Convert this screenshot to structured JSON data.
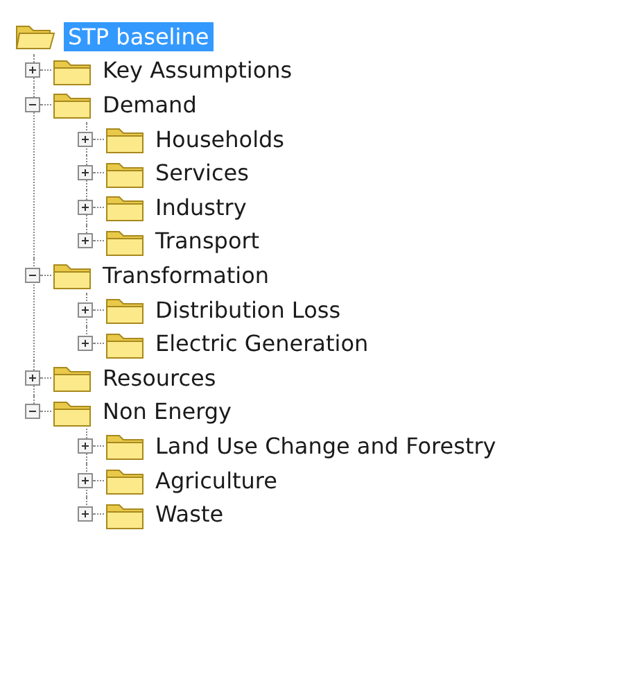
{
  "tree": {
    "label": "STP baseline",
    "selected": true,
    "children": [
      {
        "label": "Key Assumptions",
        "selected": false,
        "expanded": false
      },
      {
        "label": "Demand",
        "selected": false,
        "expanded": true,
        "children": [
          {
            "label": "Households",
            "selected": false,
            "expanded": false
          },
          {
            "label": "Services",
            "selected": false,
            "expanded": false
          },
          {
            "label": "Industry",
            "selected": false,
            "expanded": false
          },
          {
            "label": "Transport",
            "selected": false,
            "expanded": false
          }
        ]
      },
      {
        "label": "Transformation",
        "selected": false,
        "expanded": true,
        "children": [
          {
            "label": "Distribution Loss",
            "selected": false,
            "expanded": false
          },
          {
            "label": "Electric Generation",
            "selected": false,
            "expanded": false
          }
        ]
      },
      {
        "label": "Resources",
        "selected": false,
        "expanded": false
      },
      {
        "label": "Non Energy",
        "selected": false,
        "expanded": true,
        "children": [
          {
            "label": "Land Use Change and Forestry",
            "selected": false,
            "expanded": false
          },
          {
            "label": "Agriculture",
            "selected": false,
            "expanded": false
          },
          {
            "label": "Waste",
            "selected": false,
            "expanded": false
          }
        ]
      }
    ]
  }
}
